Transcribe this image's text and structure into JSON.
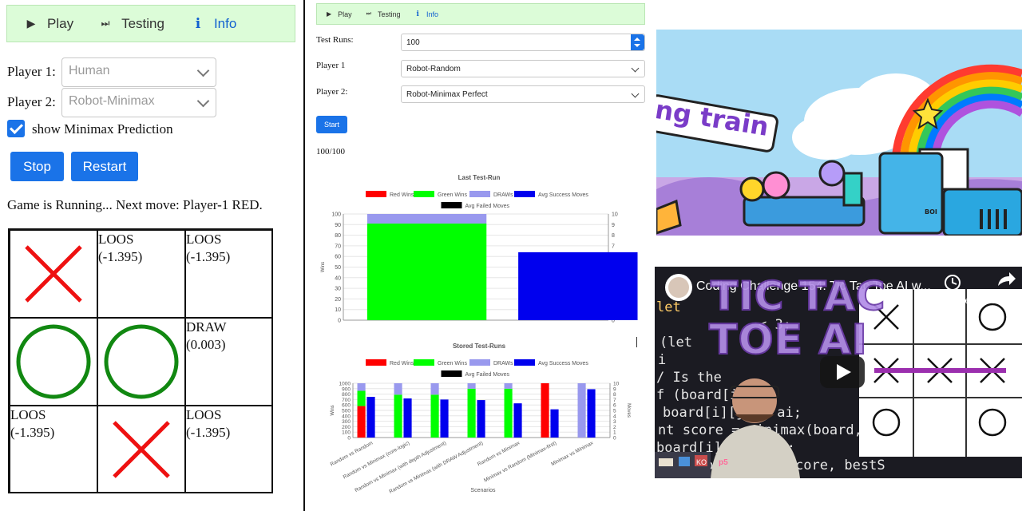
{
  "left": {
    "nav": {
      "play": "Play",
      "testing": "Testing",
      "info": "Info"
    },
    "player1": {
      "label": "Player 1:",
      "value": "Human"
    },
    "player2": {
      "label": "Player 2:",
      "value": "Robot-Minimax"
    },
    "show_prediction": {
      "label": "show Minimax Prediction",
      "checked": true
    },
    "buttons": {
      "stop": "Stop",
      "restart": "Restart"
    },
    "status": "Game is Running... Next move: Player-1 RED.",
    "board": [
      {
        "mark": "X",
        "text": "",
        "sub": ""
      },
      {
        "mark": "",
        "text": "LOOS",
        "sub": "(-1.395)"
      },
      {
        "mark": "",
        "text": "LOOS",
        "sub": "(-1.395)"
      },
      {
        "mark": "O",
        "text": "",
        "sub": ""
      },
      {
        "mark": "O",
        "text": "",
        "sub": ""
      },
      {
        "mark": "",
        "text": "DRAW",
        "sub": "(0.003)"
      },
      {
        "mark": "",
        "text": "LOOS",
        "sub": "(-1.395)"
      },
      {
        "mark": "X",
        "text": "",
        "sub": ""
      },
      {
        "mark": "",
        "text": "LOOS",
        "sub": "(-1.395)"
      }
    ],
    "colors": {
      "x": "#ee1111",
      "o": "#118811"
    }
  },
  "middle": {
    "nav": {
      "play": "Play",
      "testing": "Testing",
      "info": "Info"
    },
    "test_runs": {
      "label": "Test Runs:",
      "value": "100"
    },
    "player1": {
      "label": "Player 1",
      "value": "Robot-Random"
    },
    "player2": {
      "label": "Player 2:",
      "value": "Robot-Minimax Perfect"
    },
    "start": "Start",
    "progress": "100/100"
  },
  "chart_data": [
    {
      "type": "bar",
      "title": "Last Test-Run",
      "legend": [
        "Red Wins",
        "Green Wins",
        "DRAWs",
        "Avg Success Moves",
        "Avg Failed Moves"
      ],
      "colors": {
        "Red Wins": "#ff0000",
        "Green Wins": "#00ff00",
        "DRAWs": "#9999ee",
        "Avg Success Moves": "#0000ee",
        "Avg Failed Moves": "#000000"
      },
      "ylabel": "Wins",
      "y2label": "Moves",
      "ylim": [
        0,
        100
      ],
      "y2lim": [
        0,
        10
      ],
      "yticks": [
        0,
        10,
        20,
        30,
        40,
        50,
        60,
        70,
        80,
        90,
        100
      ],
      "y2ticks": [
        0,
        1,
        2,
        3,
        4,
        5,
        6,
        7,
        8,
        9,
        10
      ],
      "series": [
        {
          "name": "Red Wins",
          "values": [
            0
          ]
        },
        {
          "name": "Green Wins",
          "values": [
            91
          ]
        },
        {
          "name": "DRAWs",
          "values": [
            9
          ]
        },
        {
          "name": "Avg Success Moves",
          "values": [
            6.4
          ]
        }
      ]
    },
    {
      "type": "bar",
      "title": "Stored Test-Runs",
      "legend": [
        "Red Wins",
        "Green Wins",
        "DRAWs",
        "Avg Success Moves",
        "Avg Failed Moves"
      ],
      "ylabel": "Wins",
      "y2label": "Moves",
      "xlabel": "Scenarios",
      "ylim": [
        0,
        1000
      ],
      "y2lim": [
        0,
        10
      ],
      "yticks": [
        0,
        100,
        200,
        300,
        400,
        500,
        600,
        700,
        800,
        900,
        1000
      ],
      "y2ticks": [
        0,
        1,
        2,
        3,
        4,
        5,
        6,
        7,
        8,
        9,
        10
      ],
      "categories": [
        "Random vs Random",
        "Random vs Minimax (core-logic)",
        "Random vs Minimax (with depth Adjustment)",
        "Random vs Minimax (with DRAW Adjustment)",
        "Random vs Minimax",
        "Minimax vs Random (Minimax-first)",
        "Minimax vs Minimax"
      ],
      "series": [
        {
          "name": "Red Wins",
          "values": [
            580,
            0,
            0,
            0,
            0,
            1000,
            0
          ]
        },
        {
          "name": "Green Wins",
          "values": [
            280,
            790,
            790,
            900,
            900,
            0,
            0
          ]
        },
        {
          "name": "DRAWs",
          "values": [
            140,
            210,
            210,
            100,
            100,
            0,
            1000
          ]
        },
        {
          "name": "Avg Success Moves",
          "values": [
            7.5,
            7.2,
            7.0,
            6.9,
            6.3,
            5.2,
            8.9
          ]
        }
      ]
    }
  ],
  "right": {
    "top_thumb": {
      "text": "ng train",
      "sign": "BOI"
    },
    "video": {
      "title": "Coding Challenge 154: Tic Tac Toe AI w...",
      "watch_later": "Watch later",
      "share": "Share",
      "overlay_line1": "TIC TAC",
      "overlay_line2": "TOE AI",
      "code_lines": [
        "let",
        "< 3;",
        "(let",
        "i",
        "/ Is the",
        "f (board[i][j]",
        "board[i][j] = ai;",
        "nt score = minimax(board,",
        "board[i][j] = '';",
        "bestScore = max(score, bestS"
      ],
      "badges": [
        "p5",
        "KO"
      ]
    }
  }
}
